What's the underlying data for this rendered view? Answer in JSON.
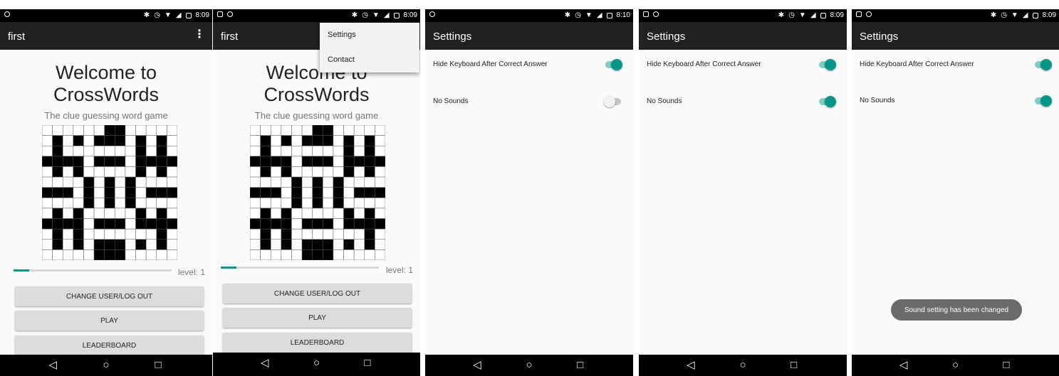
{
  "colors": {
    "accent": "#00968a",
    "appbar": "#212121",
    "status": "#000000",
    "toggle_track_on": "#80cbc4",
    "toggle_off": "#f1f1f1"
  },
  "screen1": {
    "status_time": "8:09",
    "title": "first",
    "welcome": "Welcome to CrossWords",
    "tagline": "The clue guessing word game",
    "level": "level: 1",
    "progress_fraction": 0.1,
    "buttons": [
      "CHANGE USER/LOG OUT",
      "PLAY",
      "LEADERBOARD"
    ]
  },
  "screen2": {
    "status_time": "8:09",
    "title": "first",
    "welcome": "Welcome to CrossWords",
    "tagline": "The clue guessing word game",
    "level": "level: 1",
    "progress_fraction": 0.1,
    "buttons": [
      "CHANGE USER/LOG OUT",
      "PLAY",
      "LEADERBOARD"
    ],
    "menu": [
      "Settings",
      "Contact"
    ]
  },
  "screen3": {
    "status_time": "8:10",
    "title": "Settings",
    "hide_keyboard_label": "Hide Keyboard After Correct Answer",
    "hide_keyboard_on": true,
    "no_sounds_label": "No Sounds",
    "no_sounds_on": false
  },
  "screen4": {
    "status_time": "8:09",
    "title": "Settings",
    "hide_keyboard_label": "Hide Keyboard After Correct Answer",
    "hide_keyboard_on": true,
    "no_sounds_label": "No Sounds",
    "no_sounds_on": true
  },
  "screen5": {
    "status_time": "8:09",
    "title": "Settings",
    "hide_keyboard_label": "Hide Keyboard After Correct Answer",
    "hide_keyboard_on": true,
    "no_sounds_label": "No Sounds",
    "no_sounds_on": true,
    "toast": "Sound setting has been changed"
  },
  "icons": {
    "status_left": [
      "notification-icon",
      "android-icon"
    ],
    "status_right": [
      "bluetooth-icon",
      "vibrate-icon",
      "alarm-icon",
      "wifi-icon",
      "signal-icon",
      "battery-icon"
    ],
    "nav": [
      "back-icon",
      "home-icon",
      "recents-icon"
    ],
    "overflow": "more-vert-icon"
  }
}
